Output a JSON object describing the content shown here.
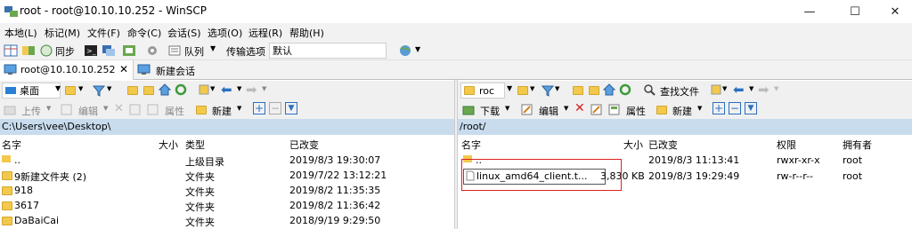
{
  "window": {
    "title": "root - root@10.10.10.252 - WinSCP",
    "minimize": "—",
    "maximize": "☐",
    "close": "✕"
  },
  "menu": [
    "本地(L)",
    "标记(M)",
    "文件(F)",
    "命令(C)",
    "会话(S)",
    "选项(O)",
    "远程(R)",
    "帮助(H)"
  ],
  "toolbar": {
    "sync_label": "同步",
    "queue_label": "队列",
    "transfer_label": "传输选项",
    "transfer_value": "默认"
  },
  "tabs": {
    "session": "root@10.10.10.252",
    "new_session": "新建会话"
  },
  "local": {
    "location": "桌面",
    "upload_label": "上传",
    "edit_label": "编辑",
    "properties_label": "属性",
    "new_label": "新建",
    "path": "C:\\Users\\vee\\Desktop\\",
    "columns": {
      "name": "名字",
      "size": "大小",
      "type": "类型",
      "changed": "已改变"
    },
    "rows": [
      {
        "name": "..",
        "size": "",
        "type": "上级目录",
        "changed": "2019/8/3  19:30:07"
      },
      {
        "name": "9新建文件夹 (2)",
        "size": "",
        "type": "文件夹",
        "changed": "2019/7/22  13:12:21"
      },
      {
        "name": "918",
        "size": "",
        "type": "文件夹",
        "changed": "2019/8/2  11:35:35"
      },
      {
        "name": "3617",
        "size": "",
        "type": "文件夹",
        "changed": "2019/8/2  11:36:42"
      },
      {
        "name": "DaBaiCai",
        "size": "",
        "type": "文件夹",
        "changed": "2018/9/19  9:29:50"
      }
    ]
  },
  "remote": {
    "location": "roc",
    "find_label": "查找文件",
    "download_label": "下载",
    "edit_label": "编辑",
    "properties_label": "属性",
    "new_label": "新建",
    "path": "/root/",
    "columns": {
      "name": "名字",
      "size": "大小",
      "changed": "已改变",
      "rights": "权限",
      "owner": "拥有者"
    },
    "rows": [
      {
        "name": "..",
        "size": "",
        "changed": "2019/8/3 11:13:41",
        "rights": "rwxr-xr-x",
        "owner": "root"
      },
      {
        "name": "linux_amd64_client.t...",
        "size": "3,830 KB",
        "changed": "2019/8/3 19:29:49",
        "rights": "rw-r--r--",
        "owner": "root"
      }
    ]
  },
  "colors": {
    "path_bg": "#c8dcee",
    "highlight": "#e02020",
    "folder": "#f2c94c"
  }
}
